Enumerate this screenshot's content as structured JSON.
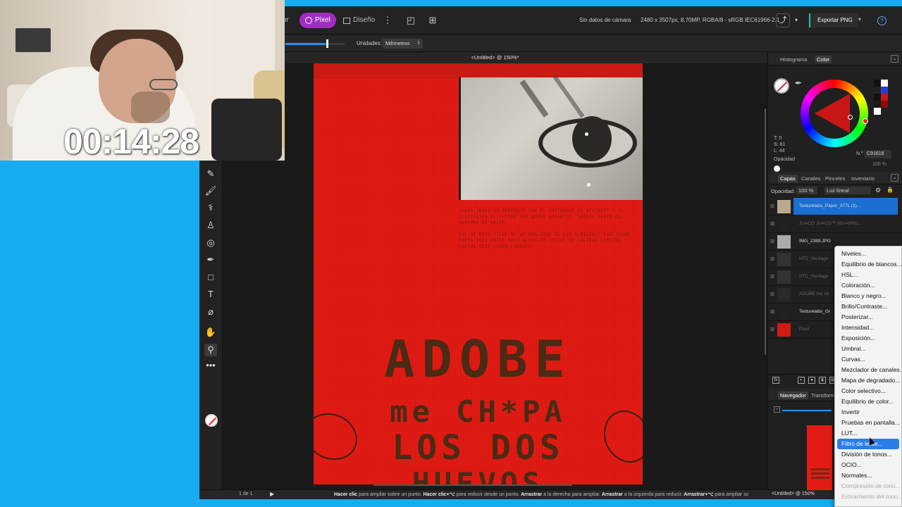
{
  "webcam": {
    "timer": "00:14:28"
  },
  "topbar": {
    "persona_prev": "or",
    "persona_pixel": "Pixel",
    "persona_design": "Diseño",
    "camera_info": "Sin datos de cámara",
    "doc_info": "2480 x 3507px, 8,70MP, RGBA/8 - sRGB IEC61966-2.1",
    "export_label": "Exportar PNG"
  },
  "contextbar": {
    "slider_value": 0.68,
    "units_label": "Unidades:",
    "units_value": "Milímetros"
  },
  "document": {
    "tab_title": "<Untitled> @ 150%*",
    "text_para_1": "JUACO JUACO NO APRENDIO CON EL PHOTOSHOP EN AFFINITY Y EL ILUSTRATOR EL FUTURO POR ADOBE SEMANTIC. SAQUES PARTE DEL CONSUMO DE HACER",
    "text_para_2": "SAL DE ESTO TIENE AL DE REALIDAD DE LOS ALMACENES FUNCIONAN FUERA SOLO ENTRE SOLO ALQUILER. FOTOS DE CALIDAD LIMITES CORTOS SEIS COMEN CAMBIEN.",
    "title_1": "ADOBE",
    "title_2": "me CH*PA",
    "title_3": "LOS DOS",
    "title_4": "HUEVOS"
  },
  "statusbar": {
    "page_count": "1 de 1",
    "hint_1": "Hacer clic",
    "hint_2": " para ampliar sobre un punto. ",
    "hint_3": "Hacer clic+⌥",
    "hint_4": " para reducir desde un punto.",
    "hint_5": "Arrastrar",
    "hint_6": " a la derecha para ampliar. ",
    "hint_7": "Arrastrar",
    "hint_8": " a la izquierda para reducir. ",
    "hint_9": "Arrastrar+⌥",
    "hint_10": " para ampliar sc",
    "doc_zoom": "<Untitled> @ 150%"
  },
  "color_panel": {
    "tabs": [
      "Histograma",
      "Color"
    ],
    "hsl": [
      "T: 0",
      "S: 81",
      "L: 44"
    ],
    "opacity_label": "Opacidad",
    "hex_label": "N.º",
    "hex_value": "C91616",
    "opacity_pct": "100 %",
    "colors": {
      "primary": "#c91616",
      "accent": "#a12ec2",
      "selection": "#1b6fd1"
    }
  },
  "layers_panel": {
    "tabs": [
      "Capas",
      "Canales",
      "Pinceles",
      "Inventario"
    ],
    "opacity_label": "Opacidad:",
    "opacity_value": "100 %",
    "blend_mode": "Luz lineal",
    "layers": [
      {
        "name": "Texturelabs_Paper_377L (1)...",
        "selected": true,
        "dim": false
      },
      {
        "name": "JUACO JUACO™ NO APRU...",
        "selected": false,
        "dim": true
      },
      {
        "name": "IMG_2389.JPG",
        "selected": false,
        "dim": false
      },
      {
        "name": "HTC_Heritage",
        "selected": false,
        "dim": true
      },
      {
        "name": "HTC_Heritage",
        "selected": false,
        "dim": true
      },
      {
        "name": "ADOBE me ch",
        "selected": false,
        "dim": true
      },
      {
        "name": "Texturelabs_Gr",
        "selected": false,
        "dim": false
      },
      {
        "name": "Pixel",
        "selected": false,
        "dim": true
      }
    ]
  },
  "navigator_panel": {
    "tabs": [
      "Navegador",
      "Transform"
    ]
  },
  "adjust_menu": {
    "items": [
      {
        "label": "Niveles...",
        "state": "normal"
      },
      {
        "label": "Equilibrio de blancos...",
        "state": "normal"
      },
      {
        "label": "HSL...",
        "state": "normal"
      },
      {
        "label": "Coloración...",
        "state": "normal"
      },
      {
        "label": "Blanco y negro...",
        "state": "normal"
      },
      {
        "label": "Brillo/Contraste...",
        "state": "normal"
      },
      {
        "label": "Posterizar...",
        "state": "normal"
      },
      {
        "label": "Intensidad...",
        "state": "normal"
      },
      {
        "label": "Exposición...",
        "state": "normal"
      },
      {
        "label": "Umbral...",
        "state": "normal"
      },
      {
        "label": "Curvas...",
        "state": "normal"
      },
      {
        "label": "Mezclador de canales...",
        "state": "normal"
      },
      {
        "label": "Mapa de degradado...",
        "state": "normal"
      },
      {
        "label": "Color selectivo...",
        "state": "normal"
      },
      {
        "label": "Equilibrio de color...",
        "state": "normal"
      },
      {
        "label": "Invertir",
        "state": "normal"
      },
      {
        "label": "Pruebas en pantalla...",
        "state": "normal"
      },
      {
        "label": "LUT...",
        "state": "normal"
      },
      {
        "label": "Filtro de lente...",
        "state": "highlighted"
      },
      {
        "label": "División de tonos...",
        "state": "normal"
      },
      {
        "label": "OCIO...",
        "state": "normal"
      },
      {
        "label": "Normales...",
        "state": "normal"
      },
      {
        "label": "Compresión de tono...",
        "state": "disabled"
      },
      {
        "label": "Estiramiento del tono...",
        "state": "disabled"
      }
    ]
  }
}
